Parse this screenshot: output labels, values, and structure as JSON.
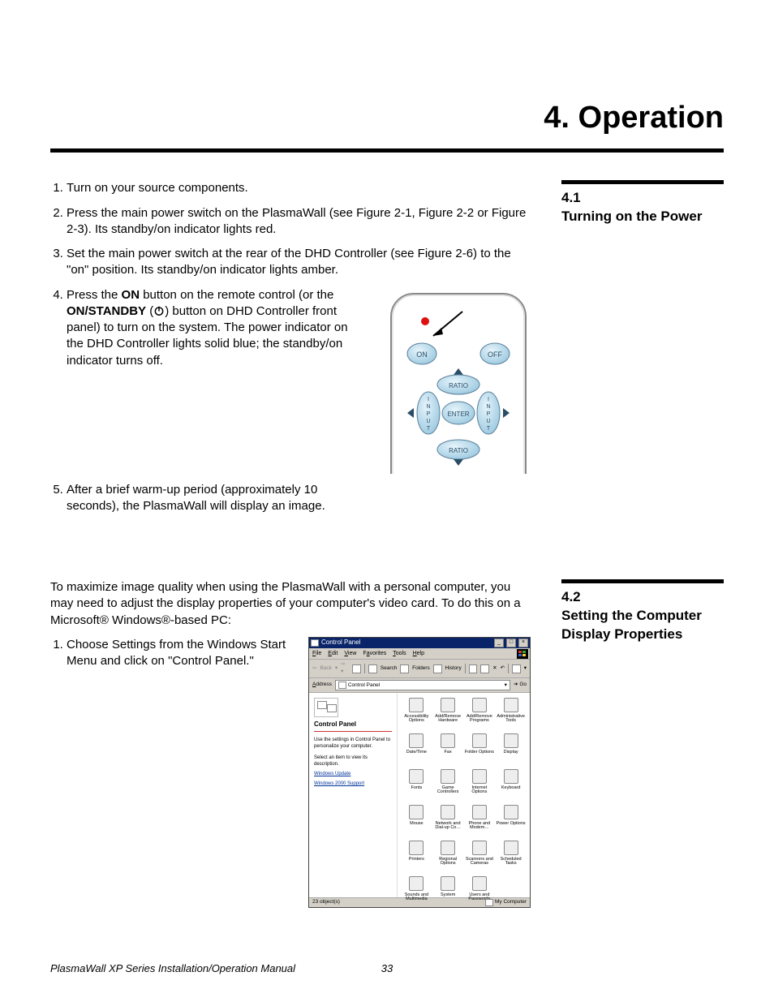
{
  "chapter": {
    "number": "4.",
    "title": "Operation"
  },
  "section41": {
    "num": "4.1",
    "title": "Turning on the Power",
    "steps": {
      "s1": "Turn on your source components.",
      "s2": "Press the main power switch on the PlasmaWall (see Figure 2-1, Figure 2-2 or Figure 2-3). Its standby/on indicator lights red.",
      "s3": "Set the main power switch at the rear of the DHD Controller (see Figure 2-6) to the \"on\" position. Its standby/on indicator lights amber.",
      "s4_a": "Press the ",
      "s4_on": "ON",
      "s4_b": " button on the remote control (or the ",
      "s4_onstandby": "ON/STANDBY",
      "s4_c": " (",
      "s4_d": ") button on DHD Controller front panel) to turn on the system. The power indicator on the DHD Controller lights solid blue; the standby/on indicator turns off.",
      "s5": "After a brief warm-up period (approximately 10 seconds), the PlasmaWall will display an image."
    }
  },
  "remote": {
    "on": "ON",
    "off": "OFF",
    "ratio": "RATIO",
    "enter": "ENTER",
    "input": "INPUT"
  },
  "section42": {
    "num": "4.2",
    "title": "Setting the Computer Display Properties",
    "intro": "To maximize image quality when using the PlasmaWall with a personal computer, you may need to adjust the display properties of your computer's video card. To do this on a Microsoft® Windows®-based PC:",
    "step1": "Choose Settings from the Windows Start Menu and click on \"Control Panel.\""
  },
  "cp": {
    "title": "Control Panel",
    "menus": [
      "File",
      "Edit",
      "View",
      "Favorites",
      "Tools",
      "Help"
    ],
    "toolbar": {
      "back": "Back",
      "search": "Search",
      "folders": "Folders",
      "history": "History"
    },
    "address_label": "Address",
    "address_value": "Control Panel",
    "go": "Go",
    "side": {
      "title": "Control Panel",
      "desc1": "Use the settings in Control Panel to personalize your computer.",
      "desc2": "Select an item to view its description.",
      "link1": "Windows Update",
      "link2": "Windows 2000 Support"
    },
    "icons": [
      "Accessibility Options",
      "Add/Remove Hardware",
      "Add/Remove Programs",
      "Administrative Tools",
      "Date/Time",
      "Fax",
      "Folder Options",
      "Display",
      "Fonts",
      "Game Controllers",
      "Internet Options",
      "Keyboard",
      "Mouse",
      "Network and Dial-up Co…",
      "Phone and Modem…",
      "Power Options",
      "Printers",
      "Regional Options",
      "Scanners and Cameras",
      "Scheduled Tasks",
      "Sounds and Multimedia",
      "System",
      "Users and Passwords"
    ],
    "status_left": "23 object(s)",
    "status_right": "My Computer"
  },
  "footer": {
    "title": "PlasmaWall XP Series Installation/Operation Manual",
    "page": "33"
  }
}
